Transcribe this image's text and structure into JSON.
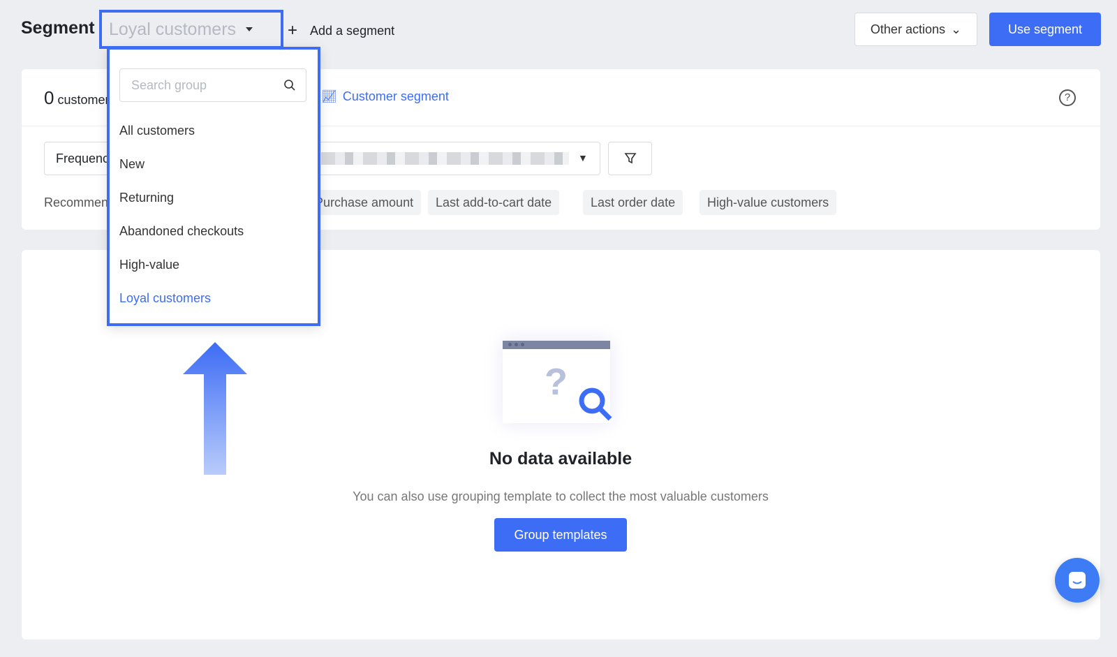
{
  "header": {
    "title": "Segment",
    "selected_segment": "Loyal customers",
    "add_segment": "Add a segment",
    "other_actions": "Other actions",
    "use_segment": "Use segment"
  },
  "summary": {
    "count": "0",
    "count_label": "customers",
    "customer_segment": "Customer segment"
  },
  "filters": {
    "field": "Frequency",
    "recommended_label": "Recommended:",
    "chips": [
      "Purchase amount",
      "Last add-to-cart date",
      "Last order date",
      "High-value customers"
    ]
  },
  "dropdown": {
    "search_placeholder": "Search group",
    "items": [
      "All customers",
      "New",
      "Returning",
      "Abandoned checkouts",
      "High-value",
      "Loyal customers"
    ],
    "selected": "Loyal customers"
  },
  "empty": {
    "title": "No data available",
    "description": "You can also use grouping template to collect the most valuable customers",
    "button": "Group templates"
  },
  "colors": {
    "accent": "#3d6cf5"
  }
}
